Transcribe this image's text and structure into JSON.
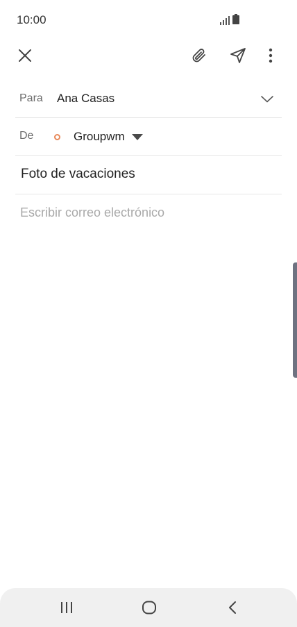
{
  "status_bar": {
    "time": "10:00"
  },
  "toolbar": {
    "icons": [
      "close-icon",
      "paperclip-icon",
      "send-icon",
      "more-vertical-icon"
    ]
  },
  "compose": {
    "to": {
      "label": "Para",
      "value": "Ana Casas"
    },
    "from": {
      "label": "De",
      "account": "Groupwm",
      "account_color": "#e8895a"
    },
    "subject": {
      "value": "Foto de vacaciones"
    },
    "body": {
      "placeholder": "Escribir correo electrónico",
      "value": ""
    }
  },
  "nav_bar": {
    "icons": [
      "recents-icon",
      "home-icon",
      "back-icon"
    ]
  }
}
